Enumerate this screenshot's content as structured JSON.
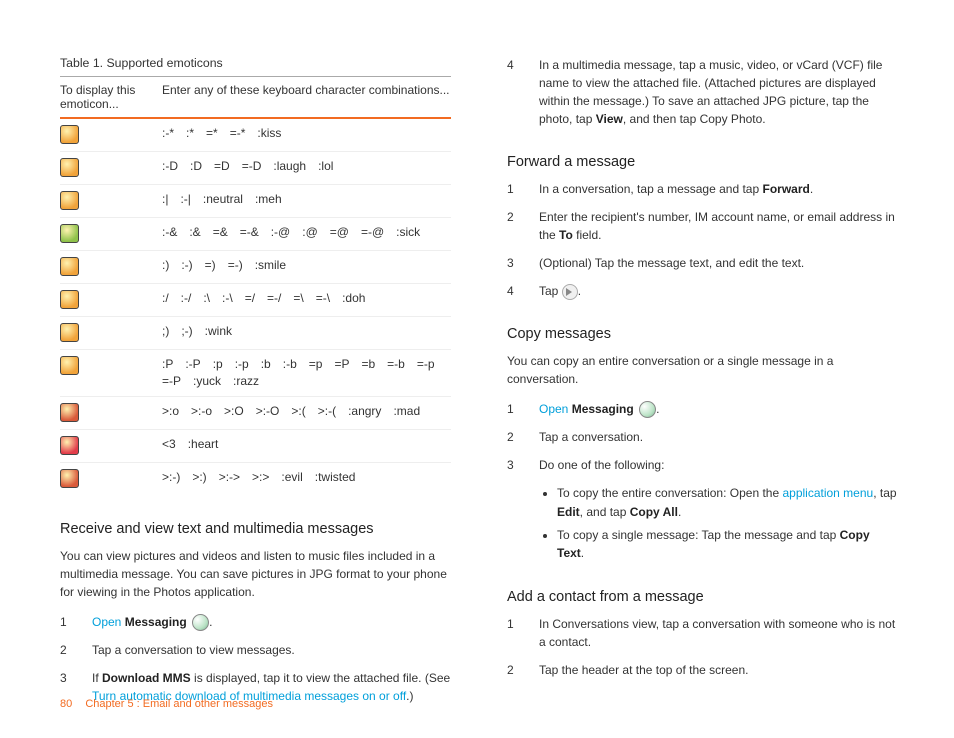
{
  "left": {
    "table_title": "Table 1.  Supported emoticons",
    "th1": "To display this emoticon...",
    "th2": "Enter any of these keyboard character combinations...",
    "rows": [
      {
        "bg": "#f1a33a",
        "codes": [
          ":-*",
          ":*",
          "=*",
          "=-*",
          ":kiss"
        ]
      },
      {
        "bg": "#f1a33a",
        "codes": [
          ":-D",
          ":D",
          "=D",
          "=-D",
          ":laugh",
          ":lol"
        ]
      },
      {
        "bg": "#f1a33a",
        "codes": [
          ":|",
          ":-|",
          ":neutral",
          ":meh"
        ]
      },
      {
        "bg": "#8fc24a",
        "codes": [
          ":-&",
          ":&",
          "=&",
          "=-&",
          ":-@",
          ":@",
          "=@",
          "=-@",
          ":sick"
        ]
      },
      {
        "bg": "#f1a33a",
        "codes": [
          ":)",
          ":-)",
          "=)",
          "=-)",
          ":smile"
        ]
      },
      {
        "bg": "#f1a33a",
        "codes": [
          ":/",
          ":-/",
          ":\\",
          ":-\\",
          "=/",
          "=-/",
          "=\\",
          "=-\\",
          ":doh"
        ]
      },
      {
        "bg": "#f1a33a",
        "codes": [
          ";)",
          ";-)",
          ":wink"
        ]
      },
      {
        "bg": "#f1a33a",
        "codes": [
          ":P",
          ":-P",
          ":p",
          ":-p",
          ":b",
          ":-b",
          "=p",
          "=P",
          "=b",
          "=-b",
          "=-p",
          "=-P",
          ":yuck",
          ":razz"
        ]
      },
      {
        "bg": "#d95a3a",
        "codes": [
          ">:o",
          ">:-o",
          ">:O",
          ">:-O",
          ">:(",
          ">:-(",
          ":angry",
          ":mad"
        ]
      },
      {
        "bg": "#e23c4a",
        "codes": [
          "<3",
          ":heart"
        ]
      },
      {
        "bg": "#d95a3a",
        "codes": [
          ">:-)",
          ">:)",
          ">:->",
          ">:>",
          ":evil",
          ":twisted"
        ]
      }
    ],
    "section1_title": "Receive and view text and multimedia messages",
    "section1_body": "You can view pictures and videos and listen to music files included in a multimedia message. You can save pictures in JPG format to your phone for viewing in the Photos application.",
    "s1_step1_open": "Open",
    "s1_step1_app": "Messaging",
    "s1_step1_dot": ".",
    "s1_step2": "Tap a conversation to view messages.",
    "s1_step3_a": "If ",
    "s1_step3_b": "Download MMS",
    "s1_step3_c": " is displayed, tap it to view the attached file. (See ",
    "s1_step3_link": "Turn automatic download of multimedia messages on or off",
    "s1_step3_d": ".)"
  },
  "right": {
    "cont_step4_a": "In a multimedia message, tap a music, video, or vCard (VCF) file name to view the attached file. (Attached pictures are displayed within the message.) To save an attached JPG picture, tap the photo, tap ",
    "cont_step4_b": "View",
    "cont_step4_c": ", and then tap Copy Photo.",
    "fwd_title": "Forward a message",
    "fwd1_a": "In a conversation, tap a message and tap ",
    "fwd1_b": "Forward",
    "fwd1_c": ".",
    "fwd2_a": "Enter the recipient's number, IM account name, or email address in the ",
    "fwd2_b": "To",
    "fwd2_c": " field.",
    "fwd3": "(Optional) Tap the message text, and edit the text.",
    "fwd4_a": "Tap ",
    "fwd4_b": ".",
    "copy_title": "Copy messages",
    "copy_body": "You can copy an entire conversation or a single message in a conversation.",
    "copy1_open": "Open",
    "copy1_app": "Messaging",
    "copy1_dot": ".",
    "copy2": "Tap a conversation.",
    "copy3": "Do one of the following:",
    "copy_b1_a": "To copy the entire conversation: Open the ",
    "copy_b1_link": "application menu",
    "copy_b1_b": ", tap ",
    "copy_b1_c": "Edit",
    "copy_b1_d": ", and tap ",
    "copy_b1_e": "Copy All",
    "copy_b1_f": ".",
    "copy_b2_a": "To copy a single message: Tap the message and tap ",
    "copy_b2_b": "Copy Text",
    "copy_b2_c": ".",
    "add_title": "Add a contact from a message",
    "add1": "In Conversations view, tap a conversation with someone who is not a contact.",
    "add2": "Tap the header at the top of the screen."
  },
  "footer": {
    "page": "80",
    "chapter": "Chapter 5 : Email and other messages"
  }
}
